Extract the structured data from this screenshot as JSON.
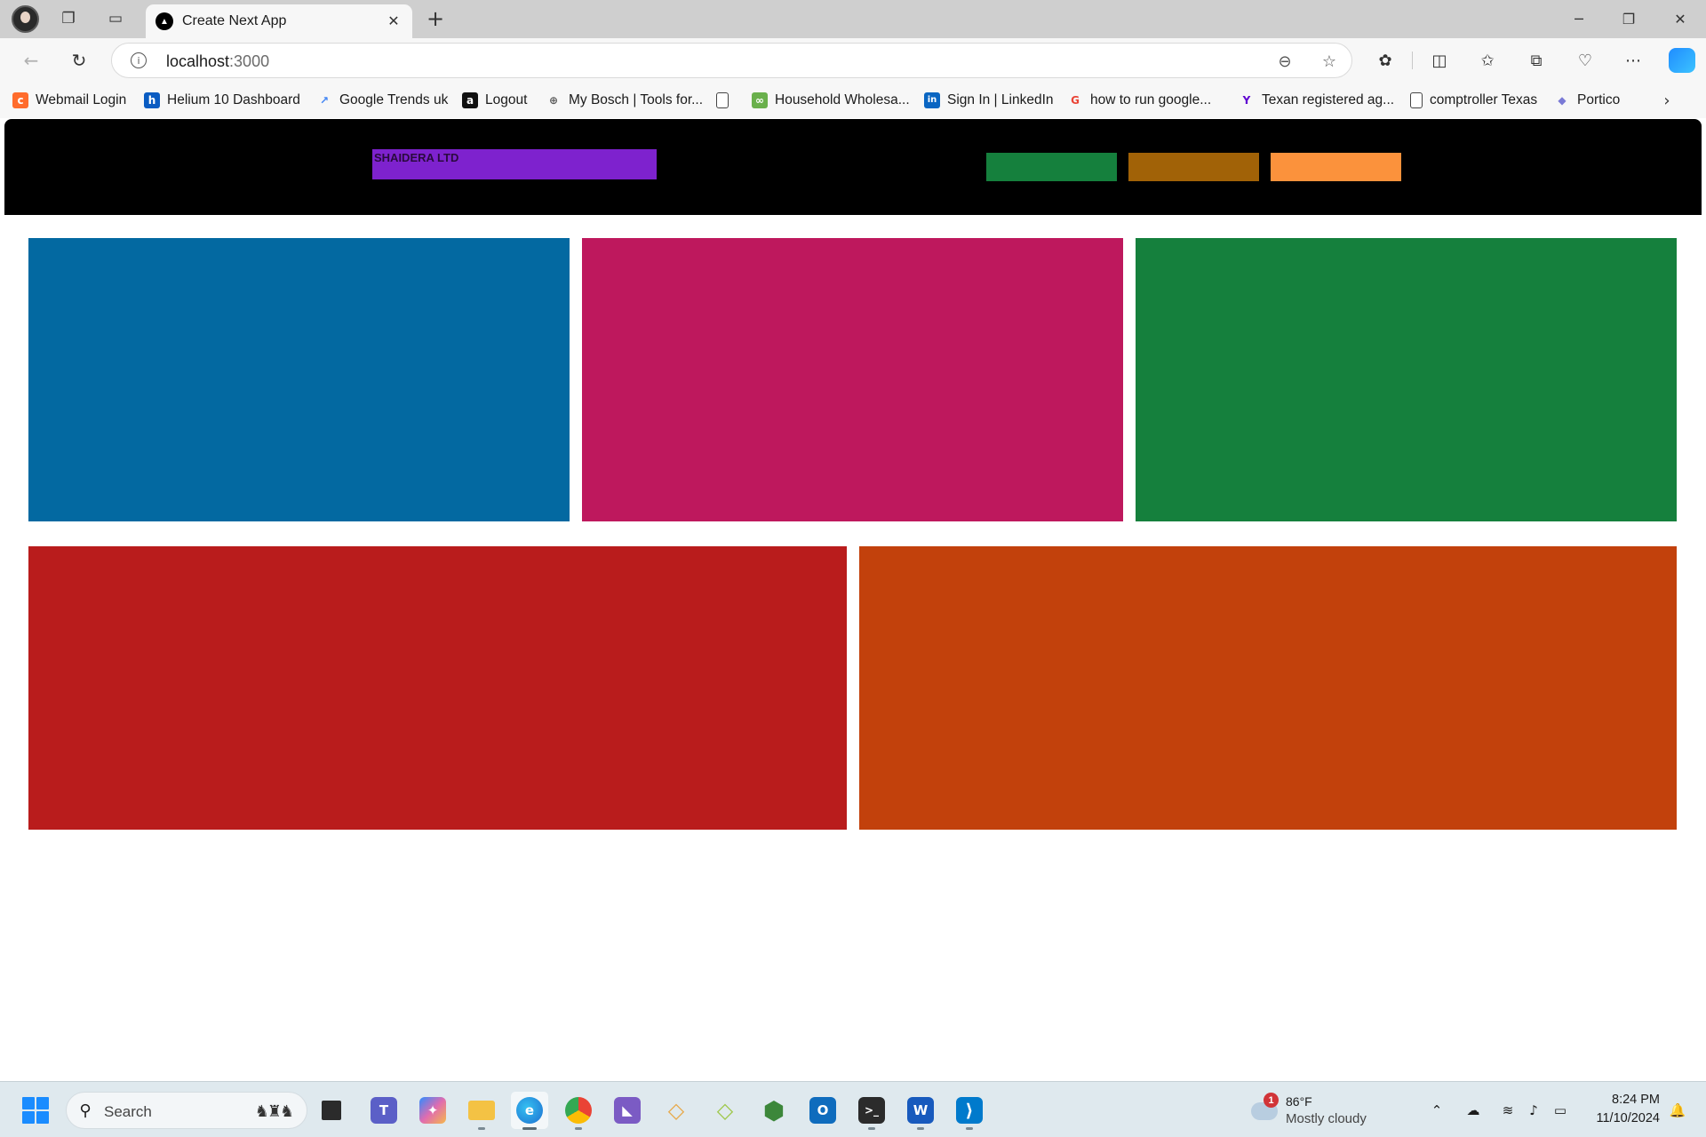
{
  "browser": {
    "tab": {
      "title": "Create Next App",
      "favicon_glyph": "▲"
    },
    "address": {
      "host": "localhost",
      "port": ":3000"
    },
    "bookmarks": [
      {
        "label": "Webmail Login",
        "icon": "cpanel-icon",
        "color": "#ff6c2c",
        "glyph": "c"
      },
      {
        "label": "Helium 10 Dashboard",
        "icon": "helium10-icon",
        "color": "#0a5cc2",
        "glyph": "h"
      },
      {
        "label": "Google Trends uk",
        "icon": "trends-icon",
        "color": "#4285f4",
        "glyph": "↗"
      },
      {
        "label": "Logout",
        "icon": "amazon-icon",
        "color": "#111111",
        "glyph": "a"
      },
      {
        "label": "My Bosch | Tools for...",
        "icon": "bosch-icon",
        "color": "#5a5a5a",
        "glyph": "⊕"
      },
      {
        "label": "",
        "icon": "page-icon",
        "color": "#f7f7f7",
        "glyph": ""
      },
      {
        "label": "Household Wholesa...",
        "icon": "household-icon",
        "color": "#6ab04c",
        "glyph": "∞"
      },
      {
        "label": "Sign In | LinkedIn",
        "icon": "linkedin-icon",
        "color": "#0a66c2",
        "glyph": "in"
      },
      {
        "label": "how to run google...",
        "icon": "google-icon",
        "color": "#ffffff",
        "glyph": "G"
      },
      {
        "label": "Texan registered ag...",
        "icon": "yahoo-icon",
        "color": "#ffffff",
        "glyph": "Y"
      },
      {
        "label": "comptroller Texas",
        "icon": "page-icon",
        "color": "#f7f7f7",
        "glyph": ""
      },
      {
        "label": "Portico",
        "icon": "portico-icon",
        "color": "#7a7ad6",
        "glyph": "◆"
      }
    ]
  },
  "site": {
    "brand": "SHAIDERA LTD",
    "colors": {
      "header_bg": "#000000",
      "brand_bg": "#7e22ce",
      "nav_buttons": [
        "#15803d",
        "#a16207",
        "#fb923c"
      ],
      "cards_top": [
        "#0369a1",
        "#be185d",
        "#15803d"
      ],
      "cards_bottom": [
        "#b91c1c",
        "#c2410c"
      ]
    }
  },
  "taskbar": {
    "search_placeholder": "Search",
    "weather": {
      "temp": "86°F",
      "desc": "Mostly cloudy",
      "badge": "1"
    },
    "clock": {
      "time": "8:24 PM",
      "date": "11/10/2024"
    },
    "apps": [
      {
        "name": "taskview-app",
        "color": "#2b2b2b",
        "glyph": "▮"
      },
      {
        "name": "teams-app",
        "color": "#5b5fc7",
        "glyph": "T"
      },
      {
        "name": "copilot-app",
        "color": "#e06cb0",
        "glyph": "✦"
      },
      {
        "name": "file-explorer-app",
        "color": "#f4c244",
        "glyph": "▬"
      },
      {
        "name": "edge-app",
        "color": "#1d8ddf",
        "glyph": "e"
      },
      {
        "name": "chrome-app",
        "color": "#34a853",
        "glyph": "◉"
      },
      {
        "name": "visual-studio-app",
        "color": "#7b5bc4",
        "glyph": "◣"
      },
      {
        "name": "kite-app",
        "color": "#e7c64a",
        "glyph": "◇"
      },
      {
        "name": "kite2-app",
        "color": "#a0c850",
        "glyph": "◇"
      },
      {
        "name": "nodejs-app",
        "color": "#3c873a",
        "glyph": "⬢"
      },
      {
        "name": "outlook-app",
        "color": "#0f6cbd",
        "glyph": "O"
      },
      {
        "name": "terminal-app",
        "color": "#2b2b2b",
        "glyph": ">_"
      },
      {
        "name": "word-app",
        "color": "#185abd",
        "glyph": "W"
      },
      {
        "name": "vscode-app",
        "color": "#007acc",
        "glyph": "⟩"
      }
    ]
  }
}
